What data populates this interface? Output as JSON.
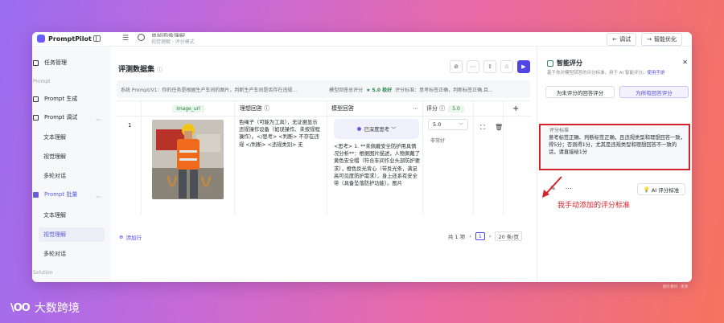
{
  "app": {
    "name": "PromptPilot"
  },
  "header": {
    "title": "单帧图像理解",
    "subtitle": "视觉理解 · 评分模式",
    "debug_label": "调试",
    "optimize_label": "智能优化"
  },
  "sidebar": {
    "items": [
      {
        "label": "任务管理"
      },
      {
        "label": "Prompt 生成"
      },
      {
        "label": "Prompt 调试"
      },
      {
        "label": "Prompt 批量"
      }
    ],
    "section_label": "Prompt",
    "debug_sub": [
      "文本理解",
      "视觉理解",
      "多轮对话"
    ],
    "batch_sub": [
      "文本理解",
      "视觉理解",
      "多轮对话"
    ],
    "footer_label": "Solution"
  },
  "main": {
    "title": "评测数据集",
    "system_prompt": "系统 Prompt/V1：你的任务是根据生产车间的图片，判断生产车间是否存在违规...",
    "overall_score_label": "模型回答总评分",
    "overall_score": "5.0 极好",
    "criteria_summary": "评分标准：意考标签正确，判断标签正确,且...",
    "columns": {
      "image": "image_url",
      "reference": "理想回答",
      "model": "模型回答",
      "score": "评分",
      "score_tag": "5.0"
    },
    "row": {
      "index": "1",
      "reference_text": "色绳子（可能为工具），无证据显示违规操作设备（如误操作、未按规程操作）。</思考> <判断> 不存在违规 </判断> <违规类别> 无",
      "thinking_pill": "已深度思考",
      "model_text": "<思考> 1. **未佩戴安全防护用具情况分析**：根据图片描述，人物佩戴了黄色安全帽（符合车间作业头部防护要求），橙色反光背心（带反光条，满足高可见度防护需求），身上还系有安全带（具备坠落防护功能）。图片",
      "score_value": "5.0",
      "score_level": "非常好"
    },
    "add_row": "添加行",
    "pager": {
      "total": "共 1 项",
      "page": "1",
      "size": "20 条/页"
    }
  },
  "panel": {
    "title": "智能评分",
    "description": "基于你对模型回答的评分标准，用于 AI 智能评分。",
    "manual_link": "使用手册",
    "tabs": [
      "为未评分的回答评分",
      "为所有回答评分"
    ],
    "criteria_label": "评分标准",
    "criteria_text": "意考标签正确、判断标签正确，且违规类型和理想回答一致，得5分；否则得1分，尤其是违规类型和理想回答不一致的话，请直接给1分",
    "ai_button": "AI 评分标准"
  },
  "annotation": "我手动添加的评分标准",
  "brand": "大数跨境",
  "footnote": "图片素材 · 来源",
  "colors": {
    "accent": "#4f46e5",
    "highlight": "#d4232a",
    "success": "#2a8a4a"
  }
}
